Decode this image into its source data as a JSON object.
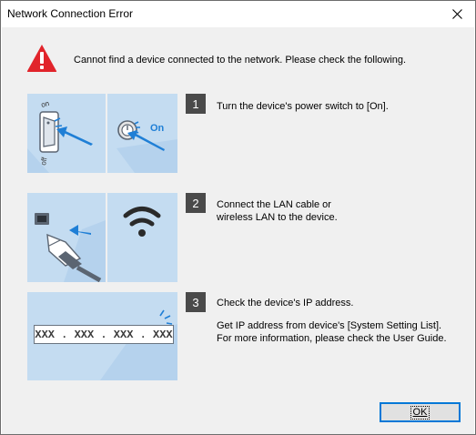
{
  "window": {
    "title": "Network Connection Error",
    "close_glyph": "✕"
  },
  "warning": {
    "icon": "warning-triangle-icon",
    "icon_color": "#e1242b",
    "message": "Cannot find a device connected to the network. Please check the following."
  },
  "steps": [
    {
      "number": "1",
      "lines": [
        "Turn the device's power switch to [On]."
      ],
      "images": [
        "power-switch-illustration",
        "power-button-on-illustration"
      ],
      "on_label": "On",
      "switch_on_label": "on",
      "switch_off_label": "off"
    },
    {
      "number": "2",
      "lines": [
        "Connect the LAN cable or",
        "wireless LAN to the device."
      ],
      "images": [
        "lan-cable-illustration",
        "wifi-illustration"
      ]
    },
    {
      "number": "3",
      "lines": [
        "Check the device's IP address.",
        "Get IP address from device's [System Setting List].",
        "For more information, please check the User Guide."
      ],
      "images": [
        "ip-address-illustration"
      ],
      "ip_placeholder": "XXX . XXX . XXX . XXX"
    }
  ],
  "colors": {
    "panel_bg": "#c4dcf1",
    "accent_blue": "#1f7fd6",
    "badge_bg": "#4a4a4a"
  },
  "buttons": {
    "ok_label": "OK"
  }
}
